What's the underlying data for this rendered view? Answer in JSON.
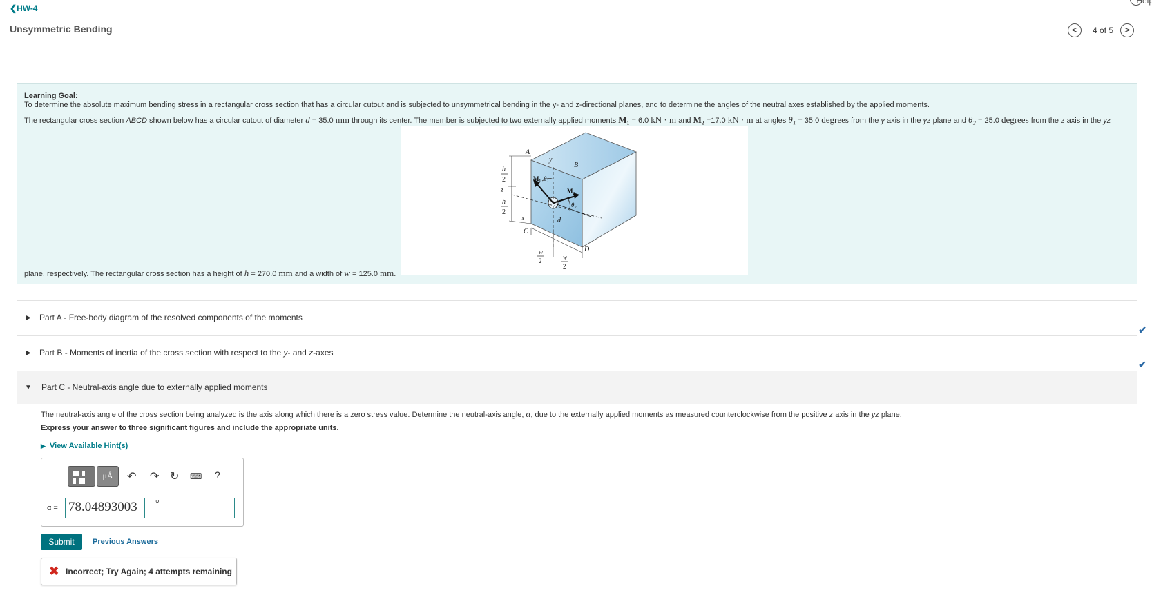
{
  "header": {
    "back_label": "HW-4",
    "help_label": "Help",
    "title": "Unsymmetric Bending",
    "page_count": "4 of 5",
    "prev_symbol": "<",
    "next_symbol": ">"
  },
  "learning_goal": {
    "title": "Learning Goal:",
    "text": "To determine the absolute maximum bending stress in a rectangular cross section that has a circular cutout and is subjected to unsymmetrical bending in the y- and z-directional planes, and to determine the angles of the neutral axes established by the applied moments."
  },
  "problem": {
    "line1_a": "The rectangular cross section ",
    "abcd": "ABCD",
    "line1_b": " shown below has a circular cutout of diameter ",
    "d_sym": "d",
    "d_value": " = 35.0 ",
    "d_unit": "mm",
    "line1_c": " through its center. The member is subjected to two externally applied moments ",
    "m1_sym": "M₁",
    "m1_value": " = 6.0 ",
    "m1_unit": "kN · m",
    "and1": " and ",
    "m2_sym": "M₂",
    "m2_value": " =17.0 ",
    "m2_unit": "kN · m",
    "line1_d": " at angles ",
    "theta1_sym": "θ₁",
    "theta1_value": " = 35.0 ",
    "theta1_unit": "degrees",
    "line1_e": " from the ",
    "y_axis": "y",
    "line1_f": " axis in the ",
    "yz1": "yz",
    "line1_g": " plane and ",
    "theta2_sym": "θ₂",
    "theta2_value": " = 25.0 ",
    "theta2_unit": "degrees",
    "line1_h": " from the ",
    "z_axis": "z",
    "line1_i": " axis in the ",
    "yz2": "yz",
    "line2_a": "plane, respectively. The rectangular cross section has a height of ",
    "h_sym": "h",
    "h_value": " = 270.0 ",
    "h_unit": "mm",
    "line2_b": " and a width of ",
    "w_sym": "w",
    "w_value": " = 125.0 ",
    "w_unit": "mm",
    "line2_c": "."
  },
  "figure_labels": {
    "A": "A",
    "B": "B",
    "C": "C",
    "D": "D",
    "y": "y",
    "z": "z",
    "x": "x",
    "h_num": "h",
    "two": "2",
    "w_num": "w",
    "M1": "M₁",
    "M2": "M₂",
    "theta1": "θ₁",
    "theta2": "θ₂",
    "d": "d"
  },
  "parts": [
    {
      "label_prefix": "Part A",
      "label_text": " - Free-body diagram of the resolved components of the moments",
      "completed": true
    },
    {
      "label_prefix": "Part B",
      "label_text": " - Moments of inertia of the cross section with respect to the ",
      "y": "y",
      "mid": "- and ",
      "z": "z",
      "end": "-axes",
      "completed": true
    },
    {
      "label_prefix": "Part C",
      "label_text": " - Neutral-axis angle due to externally applied moments",
      "completed": false
    }
  ],
  "part_c": {
    "question_a": "The neutral-axis angle of the cross section being analyzed is the axis along which there is a zero stress value. Determine the neutral-axis angle, ",
    "alpha": "α",
    "question_b": ", due to the externally applied moments as measured counterclockwise from the positive ",
    "z": "z",
    "question_c": " axis in the ",
    "yz": "yz",
    "question_d": " plane.",
    "instruction": "Express your answer to three significant figures and include the appropriate units.",
    "hints_label": "View Available Hint(s)",
    "answer_label": "α =",
    "answer_value": "78.04893003",
    "unit_value": "°",
    "units_button": "μÅ",
    "help_symbol": "?",
    "submit_label": "Submit",
    "previous_answers_label": "Previous Answers",
    "feedback_text": "Incorrect; Try Again; 4 attempts remaining"
  },
  "colors": {
    "accent": "#007c89",
    "goal_background": "#e8f6f6",
    "error": "#d0271d",
    "check": "#2b6aa6"
  }
}
